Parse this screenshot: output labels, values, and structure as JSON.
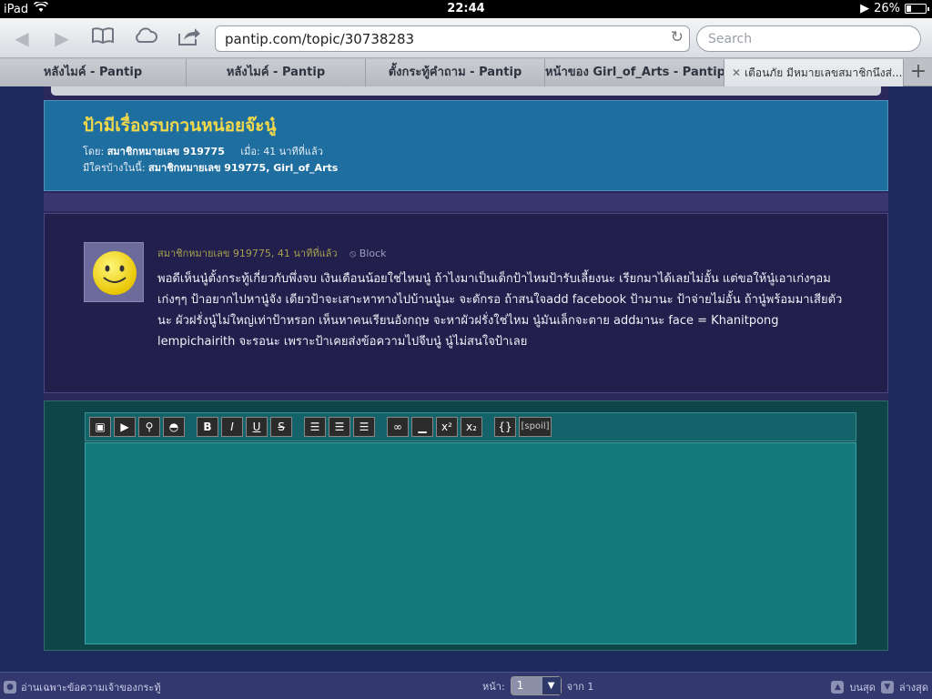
{
  "status_bar": {
    "device": "iPad",
    "time": "22:44",
    "battery": "26%",
    "battery_level": 0.26
  },
  "toolbar": {
    "url": "pantip.com/topic/30738283",
    "search_placeholder": "Search"
  },
  "tabs": [
    {
      "label": "หลังไมค์ - Pantip"
    },
    {
      "label": "หลังไมค์ - Pantip"
    },
    {
      "label": "ตั้งกระทู้คำถาม - Pantip"
    },
    {
      "label": "หน้าของ Girl_of_Arts - Pantip"
    },
    {
      "label": "เตือนภัย มีหมายเลขสมาชิกนึงส่..."
    }
  ],
  "topic": {
    "title": "ป้ามีเรื่องรบกวนหน่อยจ๊ะนู๋",
    "by_label": "โดย:",
    "author": "สมาชิกหมายเลข 919775",
    "when_label": "เมื่อ:",
    "when": "41 นาทีที่แล้ว",
    "viewers_label": "มีใครบ้างในนี้:",
    "viewers": "สมาชิกหมายเลข 919775, Girl_of_Arts"
  },
  "post": {
    "meta": "สมาชิกหมายเลข 919775, 41 นาทีที่แล้ว",
    "block_label": "Block",
    "body": "พอดีเห็นนู๋ตั้งกระทู้เกี่ยวกับพึ่งจบ เงินเดือนน้อยใช่ไหมนู๋  ถ้าไงมาเป็นเด็กป้าไหมป้ารับเลี้ยงนะ เรียกมาได้เลยไม่อั้น แต่ขอให้นู๋เอาเก่งๆอมเก่งๆๆ ป้าอยากไปหานู๋จัง เดียวป้าจะเสาะหาทางไปบ้านนู๋นะ จะดักรอ  ถ้าสนใจadd facebook ป้ามานะ ป้าจ่ายไม่อั้น ถ้านู๋พร้อมมาเสียตัวนะ ผัวฝรั่งนู๋ไม่ใหญ่เท่าป้าหรอก เห็นหาคนเรียนอังกฤษ จะหาผัวฝรั่งใช่ไหม นู๋มันเล็กจะตาย addมานะ face = Khanitpong lempichairith จะรอนะ เพราะป้าเคยส่งข้อความไปจีบนู๋ นู๋ไม่สนใจป้าเลย"
  },
  "editor": {
    "bold": "B",
    "italic": "I",
    "underline": "U",
    "strike": "S",
    "sup": "x²",
    "sub": "x₂",
    "code": "{}",
    "spoil": "[spoil]"
  },
  "bottom_bar": {
    "owner_only": "อ่านเฉพาะข้อความเจ้าของกระทู้",
    "page_label": "หน้า:",
    "page_value": "1",
    "of_label": "จาก 1",
    "top_label": "บนสุด",
    "bottom_label": "ล่างสุด"
  }
}
